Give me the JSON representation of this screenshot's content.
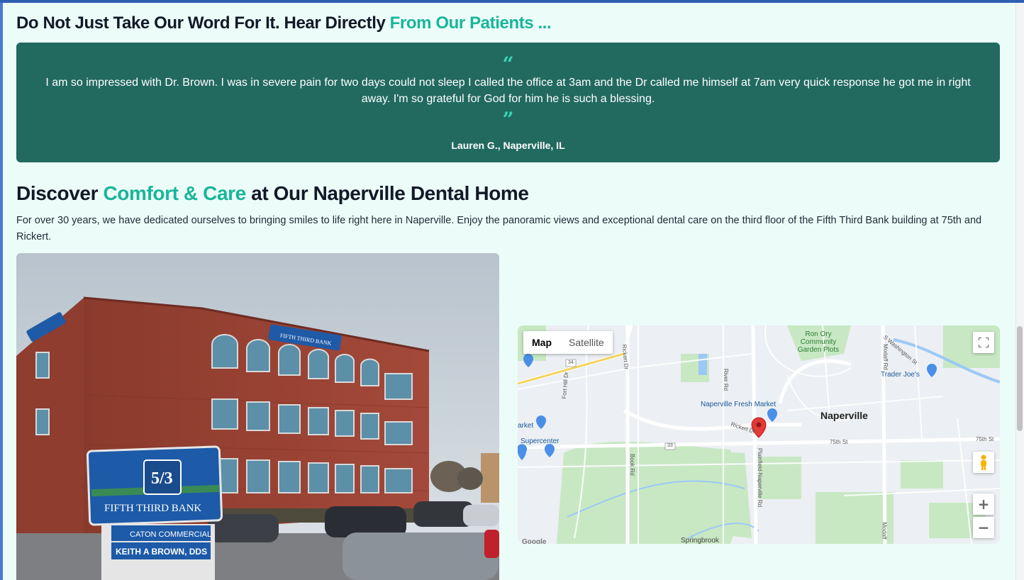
{
  "reviews": {
    "heading_main": "Do Not Just Take Our Word For It. Hear Directly ",
    "heading_highlight": "From Our Patients ...",
    "quote_open": "“",
    "quote_close": "”",
    "text": "I am so impressed with Dr. Brown. I was in severe pain for two days could not sleep I called the office at 3am and the Dr called me himself at 7am very quick response he got me in right away. I'm so grateful for God for him he is such a blessing.",
    "author": "Lauren G., Naperville, IL"
  },
  "discover": {
    "heading_pre": "Discover ",
    "heading_highlight": "Comfort & Care",
    "heading_post": " at Our Naperville Dental Home",
    "intro": "For over 30 years, we have dedicated ourselves to bringing smiles to life right here in Naperville. Enjoy the panoramic views and exceptional dental care on the third floor of the Fifth Third Bank building at 75th and Rickert."
  },
  "photo": {
    "building_sign": "FIFTH THIRD BANK",
    "monument_logo": "5/3",
    "monument_bank": "FIFTH THIRD BANK",
    "tenant_1": "CATON COMMERCIAL",
    "tenant_2": "KEITH A BROWN, DDS"
  },
  "map": {
    "tab_map": "Map",
    "tab_satellite": "Satellite",
    "zoom_in": "+",
    "zoom_out": "−",
    "city": "Naperville",
    "labels": {
      "park": "Ron Ory Community Garden Plots",
      "trader_joes": "Trader Joe's",
      "fresh_market": "Naperville Fresh Market",
      "supercenter": "Supercenter",
      "market": "arket",
      "springbrook": "Springbrook",
      "google": "Google"
    },
    "roads": {
      "rickert_rd": "Rickert Dr",
      "st_75": "75th St",
      "st_75b": "75th St",
      "book_rd": "Book Rd",
      "river_rd": "River Rd",
      "modaff_rd": "Modaff Rd",
      "modaff_rd2": "Modaff",
      "washington": "S Washington St",
      "plainfield": "Plainfield-Naperville Rd",
      "fort_hill": "Fort Hill Dr",
      "r34": "34",
      "r33": "33",
      "rickert2": "Rickert Dr"
    },
    "colors": {
      "park": "#c8e8c4",
      "road": "#ffffff",
      "water": "#9cc8f5",
      "pin": "#e53935"
    }
  }
}
